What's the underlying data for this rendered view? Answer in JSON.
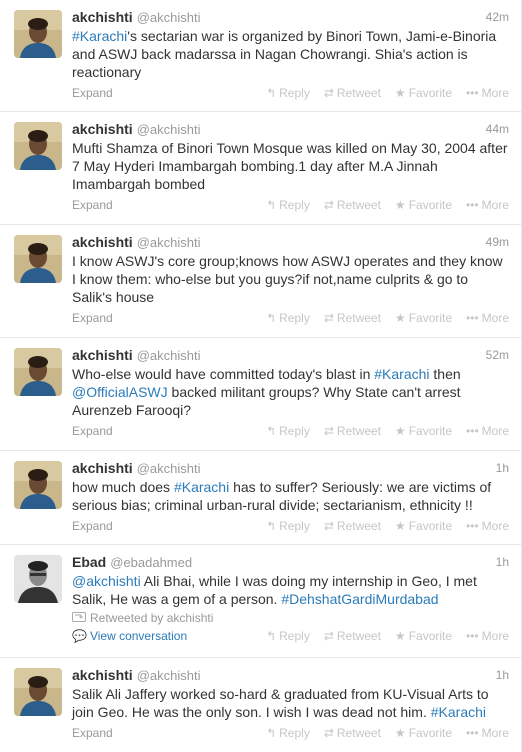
{
  "actions": {
    "reply": "Reply",
    "retweet": "Retweet",
    "favorite": "Favorite",
    "more": "More",
    "expand": "Expand",
    "view_conversation": "View conversation"
  },
  "tweets": [
    {
      "name": "akchishti",
      "handle": "@akchishti",
      "time": "42m",
      "segments": [
        {
          "t": "#Karachi",
          "link": true
        },
        {
          "t": "'s sectarian war is organized by Binori Town, Jami-e-Binoria and ASWJ back madarssa in Nagan Chowrangi. Shia's action is reactionary",
          "link": false
        }
      ]
    },
    {
      "name": "akchishti",
      "handle": "@akchishti",
      "time": "44m",
      "segments": [
        {
          "t": "Mufti Shamza of Binori Town Mosque was killed on May 30, 2004 after 7 May Hyderi Imambargah bombing.1 day after M.A Jinnah Imambargah bombed",
          "link": false
        }
      ]
    },
    {
      "name": "akchishti",
      "handle": "@akchishti",
      "time": "49m",
      "segments": [
        {
          "t": "I know ASWJ's core group;knows how ASWJ operates and they know I know them: who-else but you guys?if not,name culprits & go to Salik's house",
          "link": false
        }
      ]
    },
    {
      "name": "akchishti",
      "handle": "@akchishti",
      "time": "52m",
      "segments": [
        {
          "t": "Who-else would have committed today's blast in ",
          "link": false
        },
        {
          "t": "#Karachi",
          "link": true
        },
        {
          "t": " then ",
          "link": false
        },
        {
          "t": "@OfficialASWJ",
          "link": true
        },
        {
          "t": " backed militant groups? Why State can't arrest Aurenzeb Farooqi?",
          "link": false
        }
      ]
    },
    {
      "name": "akchishti",
      "handle": "@akchishti",
      "time": "1h",
      "segments": [
        {
          "t": "how much does ",
          "link": false
        },
        {
          "t": "#Karachi",
          "link": true
        },
        {
          "t": " has to suffer? Seriously: we are victims of serious bias; criminal urban-rural divide; sectarianism, ethnicity !!",
          "link": false
        }
      ]
    },
    {
      "name": "Ebad",
      "handle": "@ebadahmed",
      "time": "1h",
      "retweeted_by": "Retweeted by akchishti",
      "segments": [
        {
          "t": "@akchishti",
          "link": true
        },
        {
          "t": " Ali Bhai, while I was doing my internship in Geo, I met Salik, He was a gem of a person. ",
          "link": false
        },
        {
          "t": "#DehshatGardiMurdabad",
          "link": true
        }
      ]
    },
    {
      "name": "akchishti",
      "handle": "@akchishti",
      "time": "1h",
      "segments": [
        {
          "t": "Salik Ali Jaffery worked so-hard & graduated from KU-Visual Arts to join Geo. He was the only son. I wish I was dead not him. ",
          "link": false
        },
        {
          "t": "#Karachi",
          "link": true
        }
      ]
    }
  ]
}
